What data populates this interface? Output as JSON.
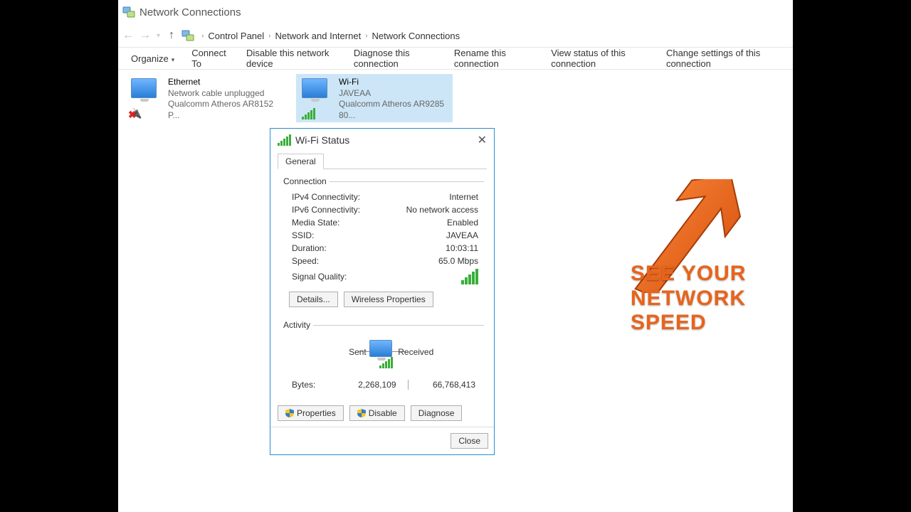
{
  "window": {
    "title": "Network Connections"
  },
  "breadcrumb": {
    "a": "Control Panel",
    "b": "Network and Internet",
    "c": "Network Connections"
  },
  "toolbar": {
    "organize": "Organize",
    "connect": "Connect To",
    "disable": "Disable this network device",
    "diagnose": "Diagnose this connection",
    "rename": "Rename this connection",
    "viewstatus": "View status of this connection",
    "change": "Change settings of this connection"
  },
  "adapters": {
    "ethernet": {
      "name": "Ethernet",
      "status": "Network cable unplugged",
      "device": "Qualcomm Atheros AR8152 P..."
    },
    "wifi": {
      "name": "Wi-Fi",
      "status": "JAVEAA",
      "device": "Qualcomm Atheros AR9285 80..."
    }
  },
  "dialog": {
    "title": "Wi-Fi Status",
    "tab": "General",
    "conn_legend": "Connection",
    "ipv4_k": "IPv4 Connectivity:",
    "ipv4_v": "Internet",
    "ipv6_k": "IPv6 Connectivity:",
    "ipv6_v": "No network access",
    "media_k": "Media State:",
    "media_v": "Enabled",
    "ssid_k": "SSID:",
    "ssid_v": "JAVEAA",
    "dur_k": "Duration:",
    "dur_v": "10:03:11",
    "speed_k": "Speed:",
    "speed_v": "65.0 Mbps",
    "sig_k": "Signal Quality:",
    "details_btn": "Details...",
    "wprops_btn": "Wireless Properties",
    "act_legend": "Activity",
    "sent_lbl": "Sent",
    "recv_lbl": "Received",
    "bytes_lbl": "Bytes:",
    "bytes_sent": "2,268,109",
    "bytes_recv": "66,768,413",
    "props_btn": "Properties",
    "disable_btn": "Disable",
    "diag_btn": "Diagnose",
    "close_btn": "Close"
  },
  "callout": {
    "l1": "SEE YOUR",
    "l2": "NETWORK SPEED"
  }
}
